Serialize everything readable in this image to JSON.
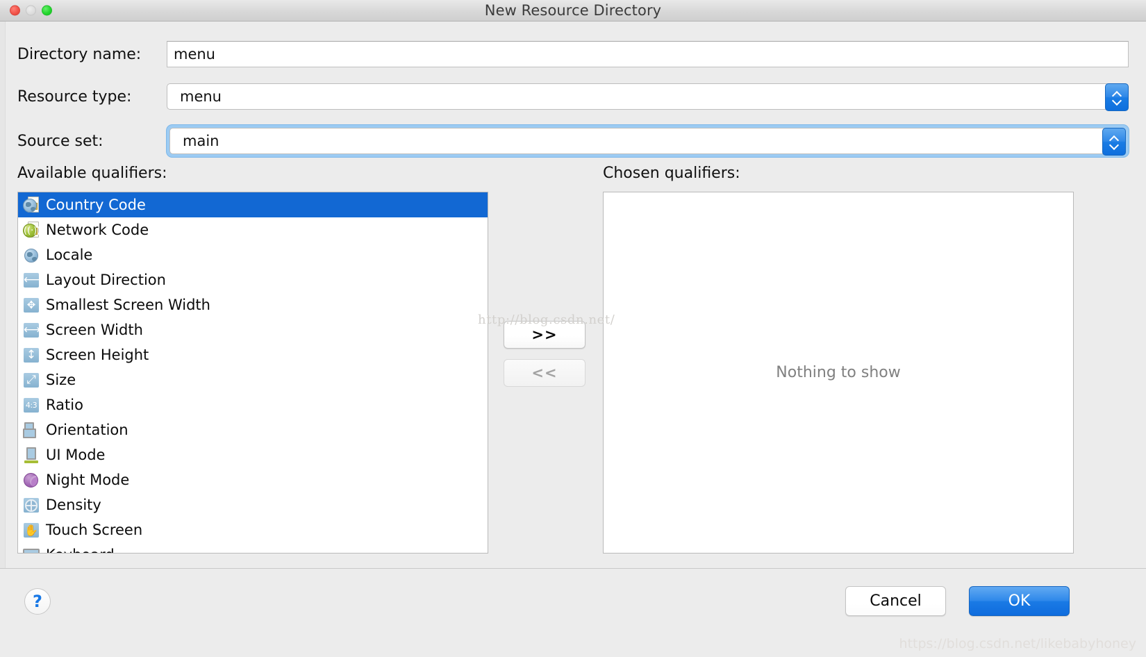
{
  "window": {
    "title": "New Resource Directory",
    "traffic_lights": [
      "close",
      "minimize",
      "zoom"
    ]
  },
  "form": {
    "directory_name": {
      "label": "Directory name:",
      "value": "menu"
    },
    "resource_type": {
      "label": "Resource type:",
      "value": "menu"
    },
    "source_set": {
      "label": "Source set:",
      "value": "main",
      "focused": true
    }
  },
  "available": {
    "heading": "Available qualifiers:",
    "items": [
      {
        "label": "Country Code",
        "icon": "country-code-icon",
        "selected": true
      },
      {
        "label": "Network Code",
        "icon": "network-code-icon",
        "selected": false
      },
      {
        "label": "Locale",
        "icon": "locale-globe-icon",
        "selected": false
      },
      {
        "label": "Layout Direction",
        "icon": "layout-direction-icon",
        "selected": false
      },
      {
        "label": "Smallest Screen Width",
        "icon": "smallest-screen-width-icon",
        "selected": false
      },
      {
        "label": "Screen Width",
        "icon": "screen-width-icon",
        "selected": false
      },
      {
        "label": "Screen Height",
        "icon": "screen-height-icon",
        "selected": false
      },
      {
        "label": "Size",
        "icon": "size-icon",
        "selected": false
      },
      {
        "label": "Ratio",
        "icon": "ratio-icon",
        "selected": false
      },
      {
        "label": "Orientation",
        "icon": "orientation-icon",
        "selected": false
      },
      {
        "label": "UI Mode",
        "icon": "ui-mode-icon",
        "selected": false
      },
      {
        "label": "Night Mode",
        "icon": "night-mode-icon",
        "selected": false
      },
      {
        "label": "Density",
        "icon": "density-icon",
        "selected": false
      },
      {
        "label": "Touch Screen",
        "icon": "touch-screen-icon",
        "selected": false
      },
      {
        "label": "Keyboard",
        "icon": "keyboard-icon",
        "selected": false
      }
    ]
  },
  "transfer": {
    "add_label": ">>",
    "add_enabled": true,
    "remove_label": "<<",
    "remove_enabled": false
  },
  "chosen": {
    "heading": "Chosen qualifiers:",
    "empty_text": "Nothing to show",
    "items": []
  },
  "footer": {
    "help_label": "?",
    "cancel_label": "Cancel",
    "ok_label": "OK"
  },
  "watermarks": {
    "center": "http://blog.csdn.net/",
    "bottom_right": "https://blog.csdn.net/likebabyhoney"
  },
  "colors": {
    "accent_blue": "#1a7ae5",
    "selection_blue": "#1268d3",
    "window_bg": "#ececec",
    "panel_bg": "#ffffff",
    "focus_ring": "#9ccbf3",
    "disabled_text": "#a3a3a3"
  }
}
